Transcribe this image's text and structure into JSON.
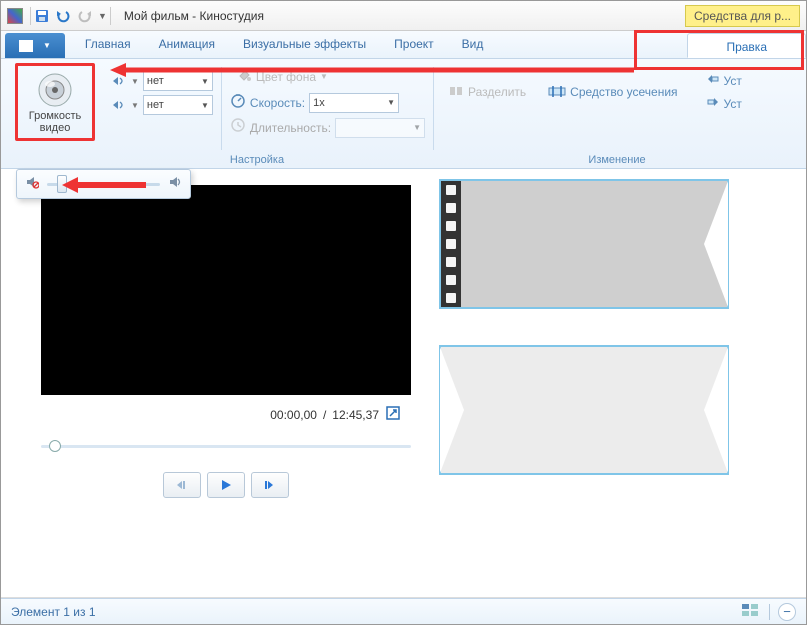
{
  "titlebar": {
    "title": "Мой фильм - Киностудия",
    "context_tab": "Средства для р..."
  },
  "tabs": {
    "home": "Главная",
    "animation": "Анимация",
    "effects": "Визуальные эффекты",
    "project": "Проект",
    "view": "Вид",
    "edit": "Правка"
  },
  "ribbon": {
    "volume_label": "Громкость видео",
    "fadein": "нет",
    "fadeout": "нет",
    "bgcolor": "Цвет фона",
    "speed_label": "Скорость:",
    "speed_value": "1x",
    "duration_label": "Длительность:",
    "group_settings": "Настройка",
    "split": "Разделить",
    "trim_tool": "Средство усечения",
    "set1": "Уст",
    "set2": "Уст",
    "group_change": "Изменение"
  },
  "preview": {
    "time_current": "00:00,00",
    "time_total": "12:45,37"
  },
  "status": {
    "item_text": "Элемент 1 из 1"
  }
}
